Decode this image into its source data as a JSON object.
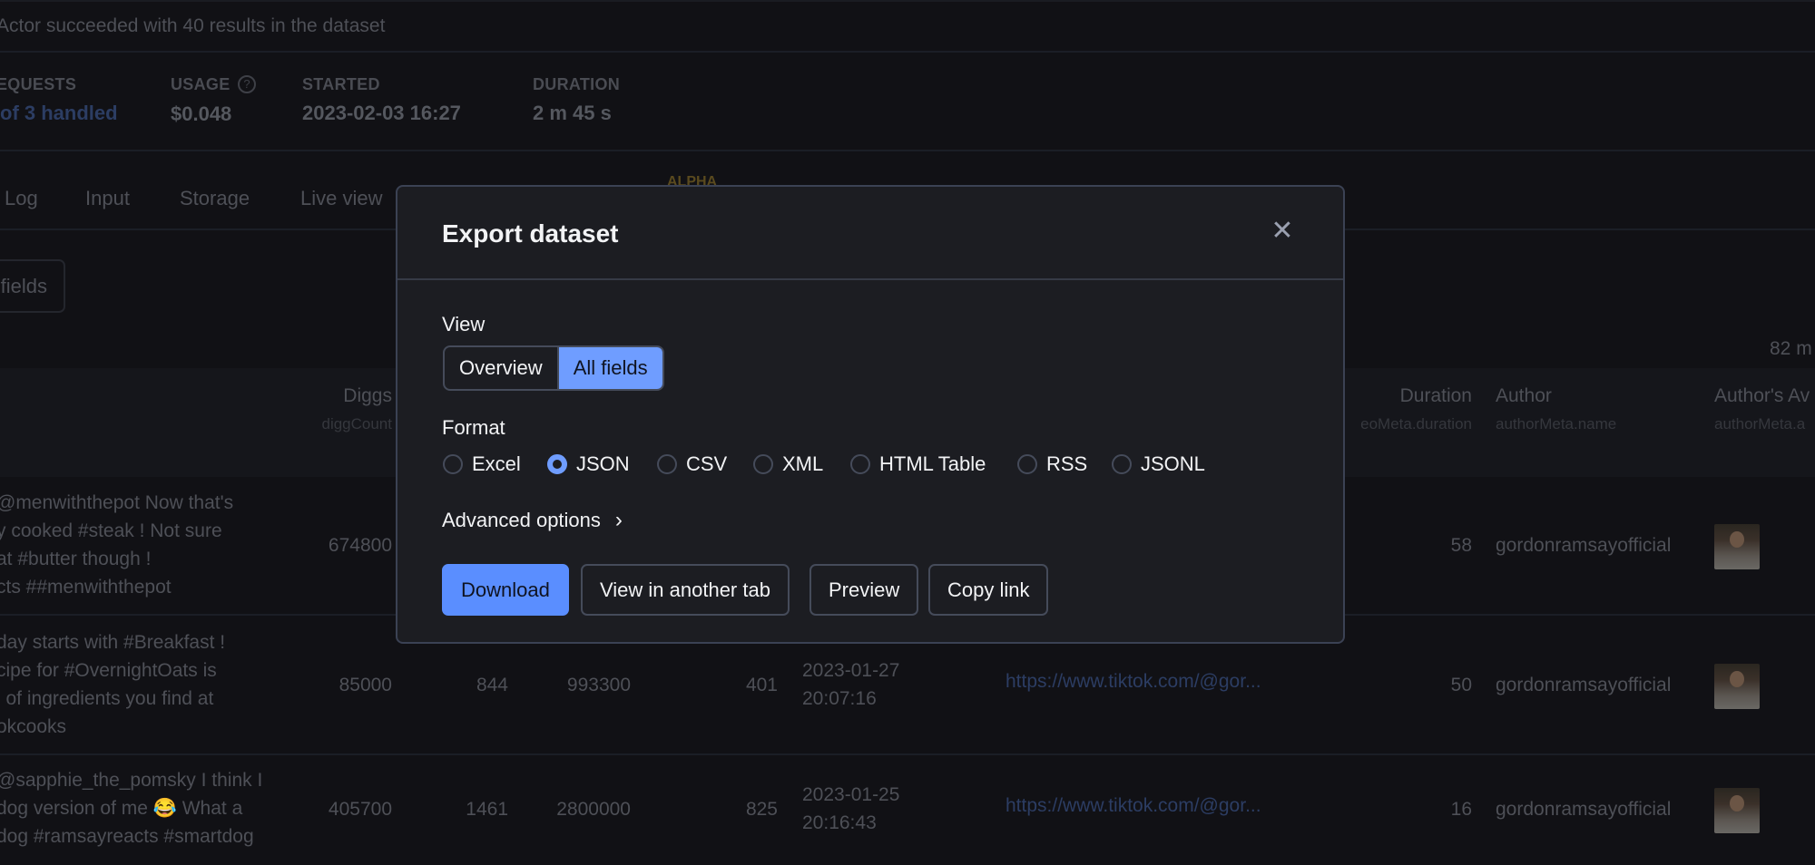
{
  "status_text": "Actor succeeded with 40 results in the dataset",
  "stats": [
    {
      "label": "EQUESTS",
      "value": "of 3 handled"
    },
    {
      "label": "USAGE",
      "value": "$0.048"
    },
    {
      "label": "STARTED",
      "value": "2023-02-03 16:27"
    },
    {
      "label": "DURATION",
      "value": "2 m 45 s"
    }
  ],
  "tabs": [
    "Log",
    "Input",
    "Storage",
    "Live view"
  ],
  "alpha_badge": "ALPHA",
  "fields_button": "fields",
  "size_text": "82 m",
  "table": {
    "headers": [
      {
        "label": "Diggs",
        "key": "diggCount"
      },
      {
        "label": "Duration",
        "key": "eoMeta.duration"
      },
      {
        "label": "Author",
        "key": "authorMeta.name"
      },
      {
        "label": "Author's Av",
        "key": "authorMeta.a"
      }
    ],
    "rows": [
      {
        "text": [
          "@menwiththepot Now that's",
          "y cooked #steak ! Not sure",
          "at #butter though !",
          "cts ##menwiththepot"
        ],
        "diggs": "674800",
        "c2": "",
        "c3": "",
        "c4": "",
        "date": "",
        "time": "",
        "url": "",
        "duration": "58",
        "author": "gordonramsayofficial"
      },
      {
        "text": [
          " day starts with #Breakfast !",
          "cipe for #OvernightOats is",
          "l of ingredients you find at",
          "okcooks"
        ],
        "diggs": "85000",
        "c2": "844",
        "c3": "993300",
        "c4": "401",
        "date": "2023-01-27",
        "time": "20:07:16",
        "url": "https://www.tiktok.com/@gor...",
        "duration": "50",
        "author": "gordonramsayofficial"
      },
      {
        "text": [
          "@sapphie_the_pomsky I think I",
          "dog version of me 😂 What a",
          "dog #ramsayreacts #smartdog"
        ],
        "diggs": "405700",
        "c2": "1461",
        "c3": "2800000",
        "c4": "825",
        "date": "2023-01-25",
        "time": "20:16:43",
        "url": "https://www.tiktok.com/@gor...",
        "duration": "16",
        "author": "gordonramsayofficial"
      }
    ]
  },
  "modal": {
    "title": "Export dataset",
    "view_label": "View",
    "view_options": [
      "Overview",
      "All fields"
    ],
    "view_selected": "All fields",
    "format_label": "Format",
    "formats": [
      "Excel",
      "JSON",
      "CSV",
      "XML",
      "HTML Table",
      "RSS",
      "JSONL"
    ],
    "format_selected": "JSON",
    "advanced_label": "Advanced options",
    "buttons": {
      "download": "Download",
      "view_tab": "View in another tab",
      "preview": "Preview",
      "copy_link": "Copy link"
    }
  },
  "colors": {
    "primary": "#5a8eff",
    "selected": "#6f9dff",
    "link": "#2c3d63",
    "alpha": "#5a4a1e"
  }
}
